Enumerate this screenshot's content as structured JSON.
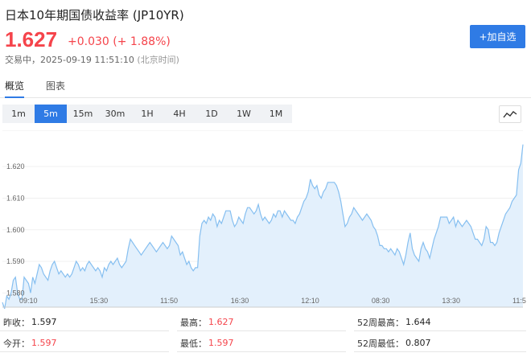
{
  "header": {
    "title": "日本10年期国债收益率 (JP10YR)",
    "price": "1.627",
    "change": "+0.030 (+ 1.88%)",
    "status": "交易中，2025-09-19 11:51:10",
    "timezone": "(北京时间)",
    "add_button": "+加自选"
  },
  "tabs": [
    {
      "label": "概览",
      "active": true
    },
    {
      "label": "图表",
      "active": false
    }
  ],
  "periods": [
    {
      "label": "1m",
      "active": false
    },
    {
      "label": "5m",
      "active": true
    },
    {
      "label": "15m",
      "active": false
    },
    {
      "label": "30m",
      "active": false
    },
    {
      "label": "1H",
      "active": false
    },
    {
      "label": "4H",
      "active": false
    },
    {
      "label": "1D",
      "active": false
    },
    {
      "label": "1W",
      "active": false
    },
    {
      "label": "1M",
      "active": false
    }
  ],
  "chart_toggle_icon": "line-chart-icon",
  "stats": {
    "prev_close_label": "昨收：",
    "prev_close": "1.597",
    "high_label": "最高：",
    "high": "1.627",
    "w52_high_label": "52周最高：",
    "w52_high": "1.644",
    "open_label": "今开：",
    "open": "1.597",
    "low_label": "最低：",
    "low": "1.597",
    "w52_low_label": "52周最低：",
    "w52_low": "0.807"
  },
  "colors": {
    "accent": "#2f7be5",
    "up": "#f5444b",
    "line": "#86bff0",
    "fill": "#e3f0fc"
  },
  "chart_data": {
    "type": "area",
    "x_tick_labels": [
      "09:10",
      "15:30",
      "11:50",
      "16:30",
      "12:10",
      "08:30",
      "13:30",
      "11:5"
    ],
    "y_tick_labels": [
      "1.580",
      "1.590",
      "1.600",
      "1.610",
      "1.620"
    ],
    "ylim": [
      1.5755,
      1.6315
    ],
    "values": [
      1.577,
      1.575,
      1.579,
      1.578,
      1.58,
      1.584,
      1.585,
      1.58,
      1.578,
      1.578,
      1.585,
      1.584,
      1.583,
      1.58,
      1.585,
      1.583,
      1.586,
      1.589,
      1.588,
      1.586,
      1.585,
      1.584,
      1.587,
      1.589,
      1.59,
      1.588,
      1.586,
      1.587,
      1.586,
      1.585,
      1.586,
      1.585,
      1.586,
      1.588,
      1.59,
      1.589,
      1.587,
      1.588,
      1.587,
      1.589,
      1.59,
      1.589,
      1.588,
      1.587,
      1.588,
      1.587,
      1.585,
      1.588,
      1.587,
      1.589,
      1.59,
      1.589,
      1.59,
      1.591,
      1.589,
      1.588,
      1.589,
      1.59,
      1.594,
      1.597,
      1.596,
      1.595,
      1.594,
      1.593,
      1.592,
      1.593,
      1.594,
      1.595,
      1.596,
      1.595,
      1.594,
      1.593,
      1.594,
      1.595,
      1.596,
      1.595,
      1.594,
      1.595,
      1.598,
      1.597,
      1.596,
      1.595,
      1.592,
      1.593,
      1.591,
      1.589,
      1.59,
      1.588,
      1.587,
      1.588,
      1.588,
      1.598,
      1.602,
      1.603,
      1.602,
      1.604,
      1.603,
      1.605,
      1.604,
      1.601,
      1.603,
      1.602,
      1.604,
      1.606,
      1.606,
      1.606,
      1.603,
      1.601,
      1.602,
      1.604,
      1.603,
      1.602,
      1.605,
      1.607,
      1.607,
      1.606,
      1.605,
      1.606,
      1.608,
      1.605,
      1.603,
      1.604,
      1.603,
      1.602,
      1.603,
      1.605,
      1.604,
      1.606,
      1.606,
      1.604,
      1.606,
      1.605,
      1.604,
      1.603,
      1.603,
      1.602,
      1.604,
      1.605,
      1.607,
      1.609,
      1.61,
      1.612,
      1.616,
      1.614,
      1.613,
      1.614,
      1.611,
      1.61,
      1.612,
      1.613,
      1.615,
      1.615,
      1.615,
      1.615,
      1.614,
      1.612,
      1.609,
      1.605,
      1.601,
      1.602,
      1.604,
      1.605,
      1.607,
      1.606,
      1.605,
      1.604,
      1.603,
      1.604,
      1.605,
      1.604,
      1.603,
      1.601,
      1.6,
      1.598,
      1.595,
      1.595,
      1.594,
      1.594,
      1.593,
      1.594,
      1.593,
      1.592,
      1.594,
      1.593,
      1.591,
      1.589,
      1.592,
      1.596,
      1.599,
      1.594,
      1.592,
      1.591,
      1.59,
      1.594,
      1.596,
      1.594,
      1.593,
      1.591,
      1.594,
      1.597,
      1.599,
      1.601,
      1.604,
      1.604,
      1.604,
      1.604,
      1.602,
      1.603,
      1.604,
      1.601,
      1.603,
      1.602,
      1.601,
      1.602,
      1.603,
      1.602,
      1.601,
      1.599,
      1.597,
      1.597,
      1.596,
      1.595,
      1.597,
      1.601,
      1.6,
      1.596,
      1.596,
      1.595,
      1.596,
      1.599,
      1.601,
      1.603,
      1.605,
      1.606,
      1.607,
      1.609,
      1.61,
      1.611,
      1.619,
      1.621,
      1.627
    ]
  }
}
